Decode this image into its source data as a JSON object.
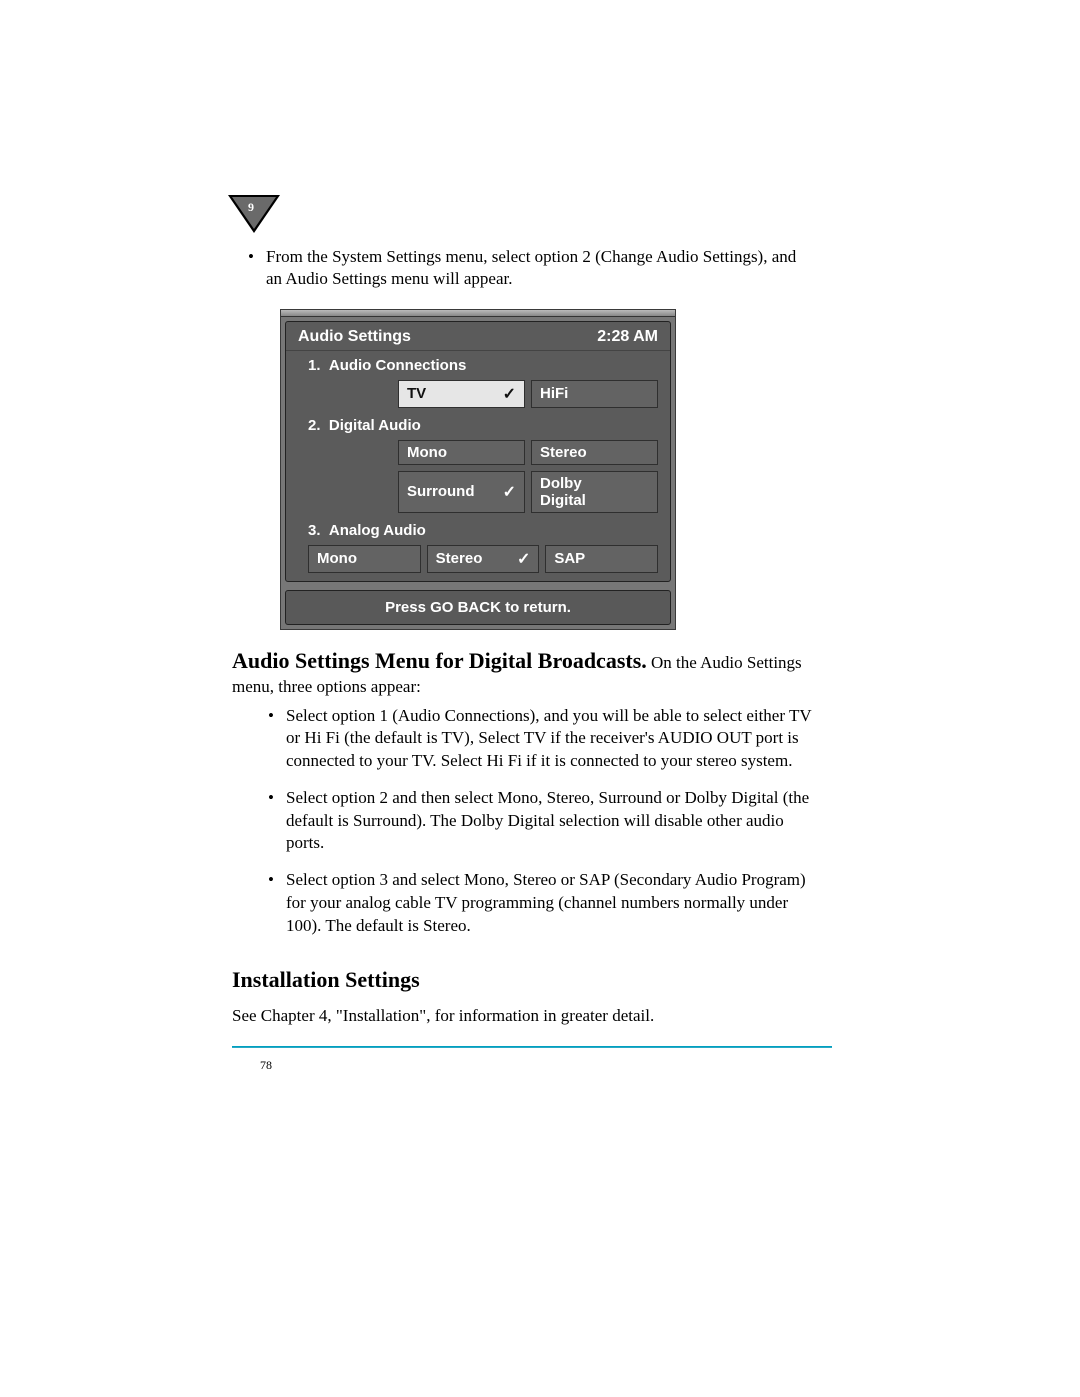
{
  "chapter_number": "9",
  "intro_bullet": "From the System Settings menu, select option 2 (Change Audio Settings), and an Audio Settings menu will appear.",
  "screenshot": {
    "title": "Audio Settings",
    "time": "2:28 AM",
    "section1": {
      "number": "1.",
      "label": "Audio Connections",
      "options": [
        {
          "label": "TV",
          "checked": true,
          "selected": true
        },
        {
          "label": "HiFi",
          "checked": false,
          "selected": false
        }
      ]
    },
    "section2": {
      "number": "2.",
      "label": "Digital Audio",
      "row1": [
        {
          "label": "Mono",
          "checked": false,
          "selected": false
        },
        {
          "label": "Stereo",
          "checked": false,
          "selected": false
        }
      ],
      "row2": [
        {
          "label": "Surround",
          "checked": true,
          "selected": false
        },
        {
          "label": "Dolby Digital",
          "checked": false,
          "selected": false
        }
      ]
    },
    "section3": {
      "number": "3.",
      "label": "Analog Audio",
      "row": [
        {
          "label": "Mono",
          "checked": false,
          "selected": false
        },
        {
          "label": "Stereo",
          "checked": true,
          "selected": false
        },
        {
          "label": "SAP",
          "checked": false,
          "selected": false
        }
      ]
    },
    "footer": "Press GO BACK  to return."
  },
  "section_heading": "Audio Settings Menu for Digital Broadcasts.",
  "section_heading_tail": " On the Audio Settings menu, three options appear:",
  "detail_bullets": [
    "Select option 1 (Audio Connections), and you will be able to select either TV or Hi Fi (the default is TV), Select TV if the receiver's AUDIO OUT port is connected to your TV. Select Hi Fi if it is connected to your stereo system.",
    "Select option 2 and then select Mono, Stereo, Surround or Dolby Digital (the default is Surround). The Dolby Digital selection will disable other audio ports.",
    "Select option 3 and select Mono, Stereo or SAP (Secondary Audio Program) for your analog cable TV programming (channel numbers normally under 100). The default is Stereo."
  ],
  "install_heading": "Installation Settings",
  "install_body": "See Chapter 4, \"Installation\", for information in greater detail.",
  "page_number": "78",
  "check_glyph": "✓"
}
